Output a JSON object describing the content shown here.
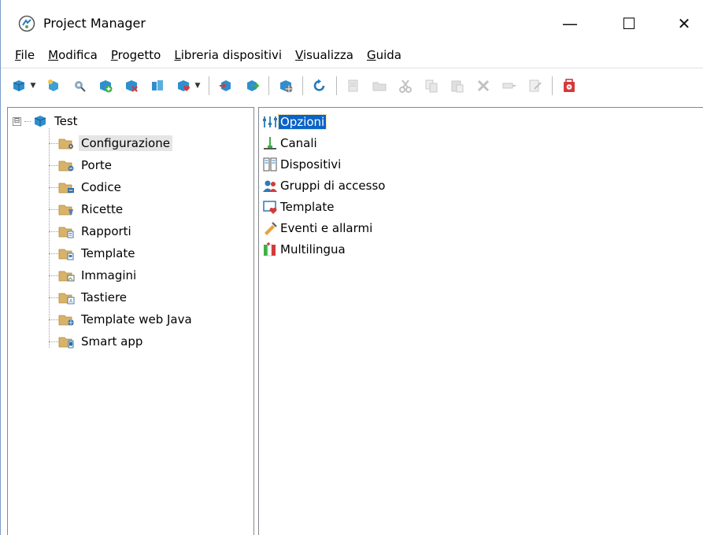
{
  "window": {
    "title": "Project Manager",
    "controls": {
      "minimize": "—",
      "maximize": "☐",
      "close": "✕"
    }
  },
  "menu": [
    {
      "label": "File"
    },
    {
      "label": "Modifica"
    },
    {
      "label": "Progetto"
    },
    {
      "label": "Libreria dispositivi"
    },
    {
      "label": "Visualizza"
    },
    {
      "label": "Guida"
    }
  ],
  "toolbar": {
    "buttons": [
      "new-project-icon",
      "new-item-icon",
      "settings-icon",
      "add-icon",
      "remove-icon",
      "project-tool-icon",
      "favorite-icon",
      "import-icon",
      "export-icon",
      "network-icon",
      "refresh-icon",
      "rename-icon",
      "new-folder-icon",
      "cut-icon",
      "copy-icon",
      "paste-icon",
      "delete-icon",
      "properties-icon",
      "edit-icon",
      "close-project-icon"
    ]
  },
  "tree": {
    "root": {
      "label": "Test",
      "expander": "⊟"
    },
    "children": [
      {
        "label": "Configurazione",
        "icon": "gear-folder-icon",
        "selected": true
      },
      {
        "label": "Porte",
        "icon": "port-folder-icon"
      },
      {
        "label": "Codice",
        "icon": "code-folder-icon"
      },
      {
        "label": "Ricette",
        "icon": "recipe-folder-icon"
      },
      {
        "label": "Rapporti",
        "icon": "report-folder-icon"
      },
      {
        "label": "Template",
        "icon": "template-folder-icon"
      },
      {
        "label": "Immagini",
        "icon": "image-folder-icon"
      },
      {
        "label": "Tastiere",
        "icon": "keyboard-folder-icon"
      },
      {
        "label": "Template web Java",
        "icon": "web-folder-icon"
      },
      {
        "label": "Smart app",
        "icon": "smartapp-folder-icon"
      }
    ]
  },
  "list": {
    "items": [
      {
        "label": "Opzioni",
        "icon": "options-icon",
        "selected": true
      },
      {
        "label": "Canali",
        "icon": "channels-icon"
      },
      {
        "label": "Dispositivi",
        "icon": "devices-icon"
      },
      {
        "label": "Gruppi di accesso",
        "icon": "access-groups-icon"
      },
      {
        "label": "Template",
        "icon": "template-icon"
      },
      {
        "label": "Eventi e allarmi",
        "icon": "events-alarms-icon"
      },
      {
        "label": "Multilingua",
        "icon": "multilanguage-icon"
      }
    ]
  },
  "colors": {
    "selection": "#0a64c8",
    "tree_selection": "#e5e5e5",
    "folder": "#d9b26a",
    "accent_blue": "#2a7ab8",
    "accent_red": "#d23b3b"
  }
}
